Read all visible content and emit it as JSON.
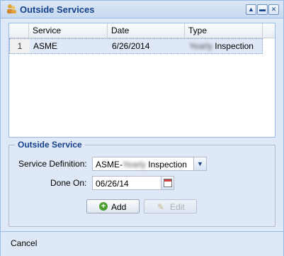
{
  "window": {
    "title": "Outside Services",
    "title_icon": "users-icon",
    "buttons": [
      "collapse-icon",
      "minimize-icon",
      "close-icon"
    ]
  },
  "grid": {
    "columns": [
      "Service",
      "Date",
      "Type"
    ],
    "rows": [
      {
        "num": "1",
        "service": "ASME",
        "date": "6/26/2014",
        "type_blurred": "Yearly",
        "type_text": "Inspection"
      }
    ]
  },
  "form": {
    "legend": "Outside Service",
    "service_definition_label": "Service Definition:",
    "service_definition_prefix": "ASME-",
    "service_definition_blurred": "Yearly",
    "service_definition_suffix": " Inspection",
    "done_on_label": "Done On:",
    "done_on_value": "06/26/14",
    "add_label": "Add",
    "edit_label": "Edit"
  },
  "footer": {
    "cancel_label": "Cancel"
  }
}
